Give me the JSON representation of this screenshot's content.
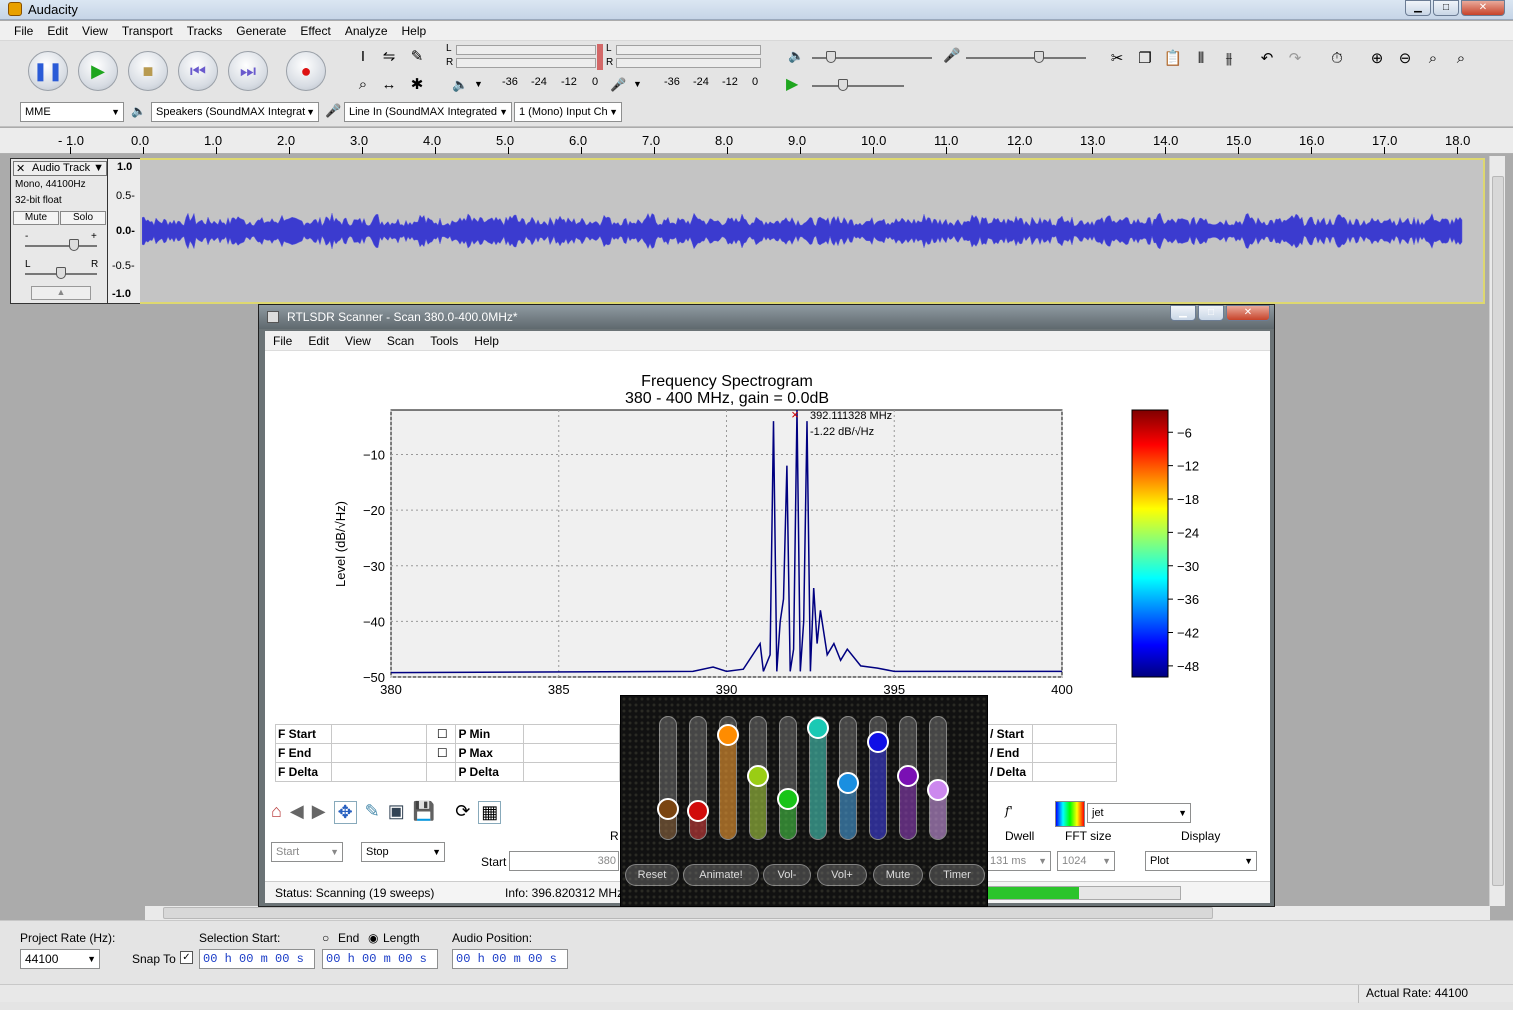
{
  "window": {
    "title": "Audacity"
  },
  "menu": [
    "File",
    "Edit",
    "View",
    "Transport",
    "Tracks",
    "Generate",
    "Effect",
    "Analyze",
    "Help"
  ],
  "meter_labels": {
    "p_l": "L",
    "p_r": "R",
    "r_l": "L",
    "r_r": "R",
    "p_scale": [
      "-36",
      "-24",
      "-12",
      "0"
    ],
    "r_scale": [
      "-36",
      "-24",
      "-12",
      "0"
    ]
  },
  "devices": {
    "host": "MME",
    "output": "Speakers (SoundMAX Integrat",
    "input": "Line In (SoundMAX Integrated",
    "channels": "1 (Mono) Input Ch"
  },
  "ruler": [
    "- 1.0",
    "0.0",
    "1.0",
    "2.0",
    "3.0",
    "4.0",
    "5.0",
    "6.0",
    "7.0",
    "8.0",
    "9.0",
    "10.0",
    "11.0",
    "12.0",
    "13.0",
    "14.0",
    "15.0",
    "16.0",
    "17.0",
    "18.0"
  ],
  "track": {
    "name": "Audio Track",
    "info1": "Mono, 44100Hz",
    "info2": "32-bit float",
    "mute": "Mute",
    "solo": "Solo",
    "gain_minus": "-",
    "gain_plus": "+",
    "pan_l": "L",
    "pan_r": "R",
    "close": "✕",
    "menu_arrow": "▼",
    "collapse": "▲",
    "scale": [
      "1.0",
      "0.5-",
      "0.0-",
      "-0.5-",
      "-1.0"
    ]
  },
  "bottom": {
    "project_rate_label": "Project Rate (Hz):",
    "project_rate": "44100",
    "snap_label": "Snap To",
    "snap_check": "✓",
    "sel_start_label": "Selection Start:",
    "end_label": "End",
    "length_label": "Length",
    "audio_pos_label": "Audio Position:",
    "time1": "00 h 00 m 00 s",
    "time2": "00 h 00 m 00 s",
    "time3": "00 h 00 m 00 s",
    "actual_rate": "Actual Rate: 44100"
  },
  "rtl": {
    "title": "RTLSDR Scanner - Scan 380.0-400.0MHz*",
    "menu": [
      "File",
      "Edit",
      "View",
      "Scan",
      "Tools",
      "Help"
    ],
    "rows": [
      {
        "a": "F Start",
        "b": "P Min",
        "c": "/ Start"
      },
      {
        "a": "F End",
        "b": "P Max",
        "c": "/ End"
      },
      {
        "a": "F Delta",
        "b": "P Delta",
        "c": "/ Delta"
      }
    ],
    "start_combo": "Start",
    "stop_combo": "Stop",
    "start_label": "Start",
    "start_value": "380",
    "r_label": "R",
    "dwell_label": "Dwell",
    "fft_label": "FFT size",
    "display_label": "Display",
    "dwell": "131 ms",
    "fft": "1024",
    "display": "Plot",
    "colormap": "jet",
    "fx": "f'",
    "status": "Status: Scanning (19 sweeps)",
    "info": "Info: 396.820312 MHz"
  },
  "chart_data": {
    "type": "line",
    "title": "Frequency Spectrogram",
    "subtitle": "380 - 400 MHz, gain = 0.0dB",
    "xlabel": "",
    "ylabel": "Level (dB/√Hz)",
    "xlim": [
      380,
      400
    ],
    "ylim": [
      -50,
      -2
    ],
    "xticks": [
      "380",
      "385",
      "390",
      "395",
      "400"
    ],
    "yticks": [
      "−10",
      "−20",
      "−30",
      "−40",
      "−50"
    ],
    "grid": true,
    "peak_label_freq": "392.111328 MHz",
    "peak_label_level": "-1.22 dB/√Hz",
    "colorbar_ticks": [
      "−6",
      "−12",
      "−18",
      "−24",
      "−30",
      "−36",
      "−42",
      "−48"
    ],
    "x": [
      380,
      389,
      389.6,
      390,
      390.5,
      391,
      391.1,
      391.3,
      391.4,
      391.5,
      391.6,
      391.7,
      391.8,
      391.9,
      392.0,
      392.1,
      392.2,
      392.3,
      392.4,
      392.5,
      392.6,
      392.7,
      392.8,
      393.0,
      393.2,
      393.4,
      393.6,
      394.0,
      394.5,
      395,
      400
    ],
    "y": [
      -49.2,
      -49,
      -48.2,
      -49,
      -48.6,
      -44,
      -49,
      -46,
      -4,
      -49,
      -40,
      -36,
      -12,
      -49,
      -45,
      -2,
      -49,
      -40,
      -4,
      -49,
      -34,
      -44,
      -38,
      -46,
      -44,
      -47,
      -45,
      -48,
      -48.4,
      -49,
      -49
    ]
  },
  "mixer": {
    "buttons": [
      "Reset",
      "Animate!",
      "Vol-",
      "Vol+",
      "Mute",
      "Timer"
    ],
    "colors": [
      "#7a4511",
      "#d10b0b",
      "#ff8c00",
      "#9acd14",
      "#18c418",
      "#1ac9b4",
      "#1a8fe0",
      "#1010e6",
      "#7a10b4",
      "#cc88ee"
    ],
    "levels": [
      0.25,
      0.23,
      0.85,
      0.52,
      0.33,
      0.9,
      0.46,
      0.79,
      0.52,
      0.4
    ]
  }
}
